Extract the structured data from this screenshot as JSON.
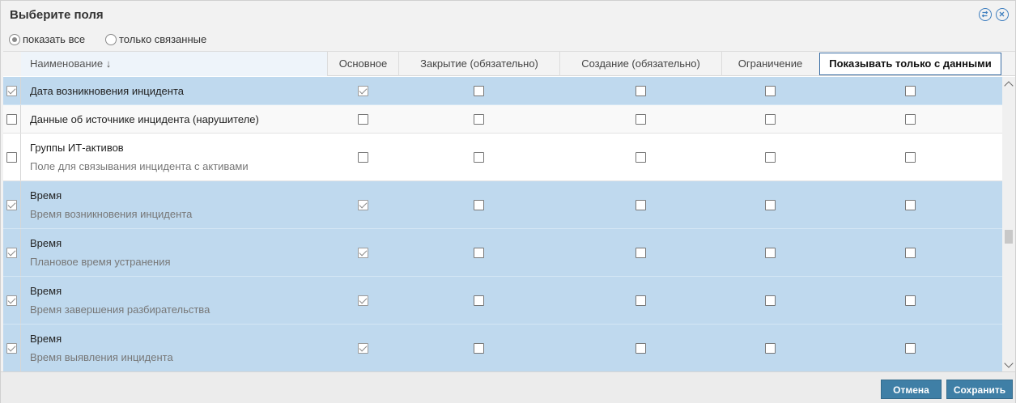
{
  "dialog": {
    "title": "Выберите поля",
    "refresh_icon": "refresh-icon",
    "close_icon": "close-icon"
  },
  "filter": {
    "show_all": "показать все",
    "only_linked": "только связанные",
    "selected": "show_all"
  },
  "columns": {
    "name": "Наименование ↓",
    "main": "Основное",
    "closing": "Закрытие (обязательно)",
    "creation": "Создание (обязательно)",
    "restriction": "Ограничение",
    "only_data": "Показывать только с данными"
  },
  "rows": [
    {
      "title": "Дата возникновения инцидента",
      "desc": "",
      "selected": true
    },
    {
      "title": "Данные об источнике инцидента (нарушителе)",
      "desc": "",
      "selected": false
    },
    {
      "title": "Группы ИТ-активов",
      "desc": "Поле для связывания инцидента с активами",
      "selected": false
    },
    {
      "title": "Время",
      "desc": "Время возникновения инцидента",
      "selected": true
    },
    {
      "title": "Время",
      "desc": "Плановое время устранения",
      "selected": true
    },
    {
      "title": "Время",
      "desc": "Время завершения разбирательства",
      "selected": true
    },
    {
      "title": "Время",
      "desc": "Время выявления инцидента",
      "selected": true
    }
  ],
  "footer": {
    "cancel": "Отмена",
    "save": "Сохранить"
  },
  "colors": {
    "selected_row": "#bfd9ee",
    "button": "#3f7fa6"
  }
}
